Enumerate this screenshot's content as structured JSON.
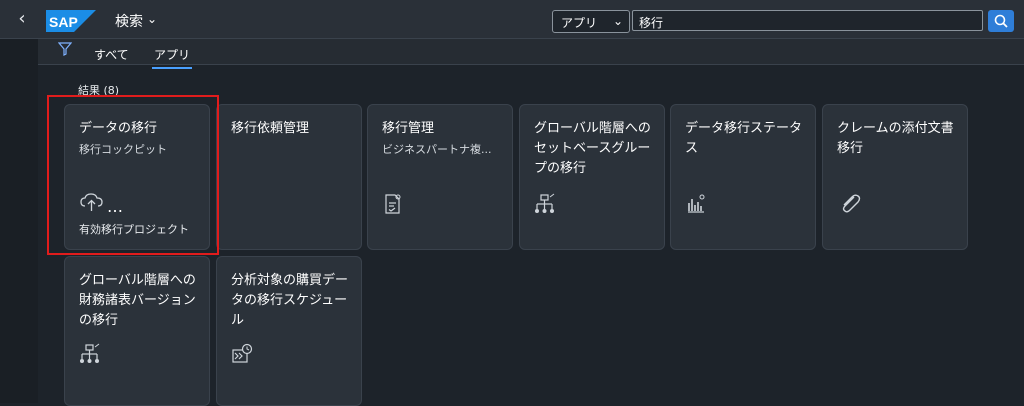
{
  "shell": {
    "back_icon": "back-chevron-icon",
    "logo_text": "SAP",
    "app_title": "検索",
    "scope_select": "アプリ",
    "search_value": "移行",
    "search_icon": "search-icon"
  },
  "tabs": [
    "すべて",
    "アプリ"
  ],
  "results_label": "結果 (8)",
  "tiles": [
    {
      "title": "データの移行",
      "subtitle": "移行コックピット",
      "footer": "有効移行プロジェクト",
      "icon": "cloud-upload-icon",
      "more": "…"
    },
    {
      "title": "移行依頼管理",
      "subtitle": "",
      "footer": "",
      "icon": ""
    },
    {
      "title": "移行管理",
      "subtitle": "ビジネスパートナ複...",
      "footer": "",
      "icon": "document-check-icon"
    },
    {
      "title": "グローバル階層へのセットベースグループの移行",
      "subtitle": "",
      "footer": "",
      "icon": "hierarchy-icon"
    },
    {
      "title": "データ移行ステータス",
      "subtitle": "",
      "footer": "",
      "icon": "bar-chart-search-icon"
    },
    {
      "title": "クレームの添付文書移行",
      "subtitle": "",
      "footer": "",
      "icon": "paperclip-icon"
    },
    {
      "title": "グローバル階層への財務諸表バージョンの移行",
      "subtitle": "",
      "footer": "",
      "icon": "hierarchy-icon"
    },
    {
      "title": "分析対象の購買データの移行スケジュール",
      "subtitle": "",
      "footer": "",
      "icon": "schedule-migration-icon"
    }
  ]
}
